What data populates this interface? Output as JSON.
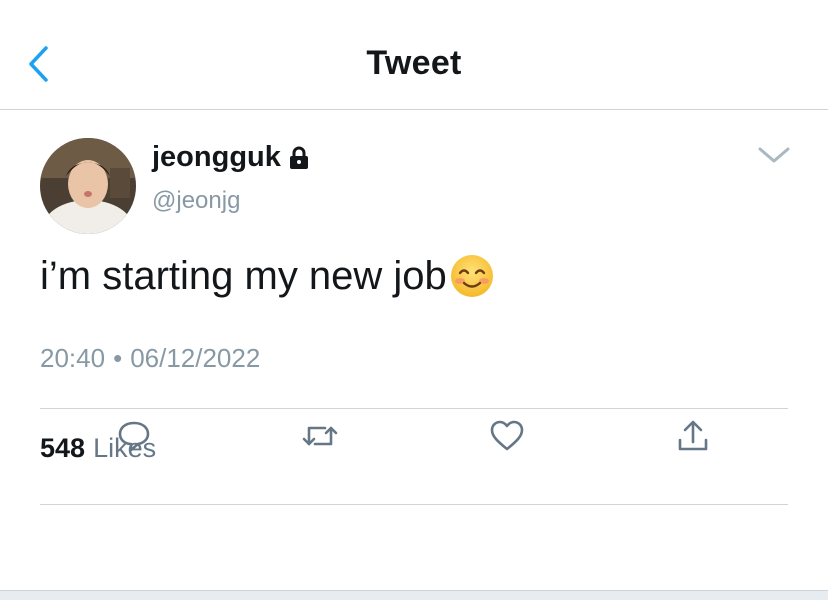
{
  "header": {
    "title": "Tweet",
    "back_icon": "chevron-left-icon",
    "accent_color": "#1da1f2"
  },
  "tweet": {
    "display_name": "jeongguk",
    "protected_icon": "lock-icon",
    "handle": "@jeonjg",
    "text": "i’m starting my new job",
    "emoji": "smiling-face-icon",
    "time": "20:40",
    "separator": "•",
    "date": "06/12/2022",
    "likes_count": "548",
    "likes_label": "Likes"
  },
  "actions": {
    "reply_icon": "reply-icon",
    "retweet_icon": "retweet-icon",
    "like_icon": "heart-icon",
    "share_icon": "share-icon"
  },
  "colors": {
    "text_primary": "#14171a",
    "text_secondary": "#8899a6",
    "icon_gray": "#657786",
    "divider": "#cfd4d8"
  }
}
